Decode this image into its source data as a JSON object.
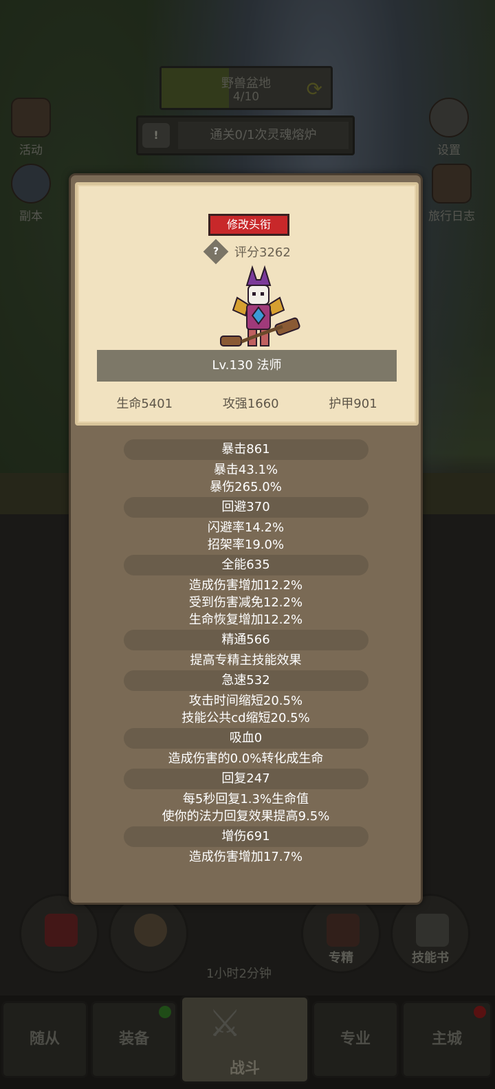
{
  "map": {
    "name": "野兽盆地",
    "progress": "4/10",
    "refresh_icon": "refresh-icon"
  },
  "quest": {
    "text": "通关0/1次灵魂熔炉"
  },
  "side_buttons": {
    "activity": "活动",
    "dungeon": "副本",
    "settings": "设置",
    "journal": "旅行日志"
  },
  "popup": {
    "change_title_button": "修改头衔",
    "score_label": "评分3262",
    "level_class": "Lv.130 法师",
    "base_stats": [
      "生命5401",
      "攻强1660",
      "护甲901"
    ],
    "stats": [
      {
        "head": "暴击861",
        "lines": [
          "暴击43.1%",
          "暴伤265.0%"
        ]
      },
      {
        "head": "回避370",
        "lines": [
          "闪避率14.2%",
          "招架率19.0%"
        ]
      },
      {
        "head": "全能635",
        "lines": [
          "造成伤害增加12.2%",
          "受到伤害减免12.2%",
          "生命恢复增加12.2%"
        ]
      },
      {
        "head": "精通566",
        "lines": [
          "提高专精主技能效果"
        ]
      },
      {
        "head": "急速532",
        "lines": [
          "攻击时间缩短20.5%",
          "技能公共cd缩短20.5%"
        ]
      },
      {
        "head": "吸血0",
        "lines": [
          "造成伤害的0.0%转化成生命"
        ]
      },
      {
        "head": "回复247",
        "lines": [
          "每5秒回复1.3%生命值",
          "使你的法力回复效果提高9.5%"
        ]
      },
      {
        "head": "增伤691",
        "lines": [
          "造成伤害增加17.7%"
        ]
      }
    ]
  },
  "bottom_actions": {
    "specialization": "专精",
    "skill_book": "技能书",
    "timer": "1小时2分钟"
  },
  "nav": {
    "followers": "随从",
    "equipment": "装备",
    "battle": "战斗",
    "profession": "专业",
    "main_city": "主城"
  }
}
